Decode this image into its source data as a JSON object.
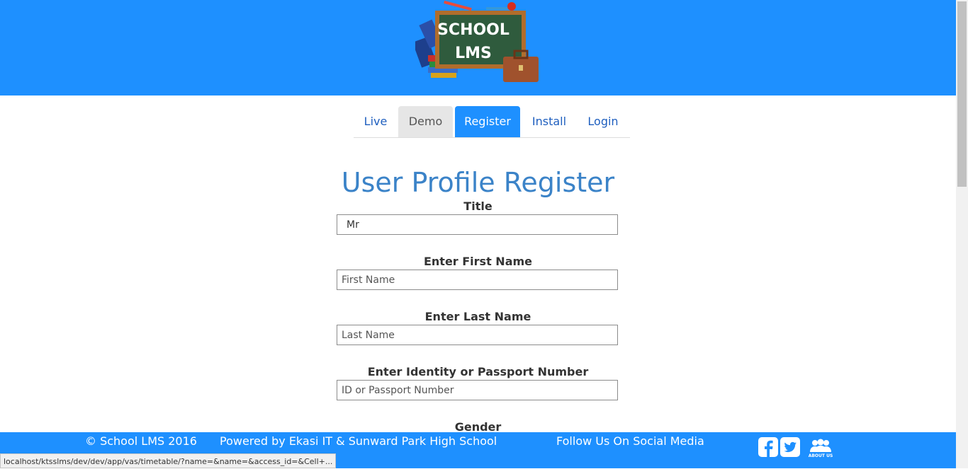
{
  "header": {
    "logo_line1": "SCHOOL",
    "logo_line2": "LMS",
    "color": "#1e90ff"
  },
  "nav": {
    "tabs": [
      {
        "label": "Live"
      },
      {
        "label": "Demo"
      },
      {
        "label": "Register",
        "active": true
      },
      {
        "label": "Install"
      },
      {
        "label": "Login"
      }
    ]
  },
  "form": {
    "title": "User Profile Register",
    "fields": [
      {
        "label": "Title",
        "value": "Mr",
        "placeholder": ""
      },
      {
        "label": "Enter First Name",
        "value": "",
        "placeholder": "First Name"
      },
      {
        "label": "Enter Last Name",
        "value": "",
        "placeholder": "Last Name"
      },
      {
        "label": "Enter Identity or Passport Number",
        "value": "",
        "placeholder": "ID or Passport Number"
      },
      {
        "label": "Gender"
      }
    ]
  },
  "footer": {
    "copyright": "© School LMS 2016",
    "powered": "Powered by Ekasi IT & Sunward Park High School",
    "follow": "Follow Us On Social Media",
    "about_label": "ABOUT US"
  },
  "status_bar": {
    "url": "localhost/ktsslms/dev/dev/app/vas/timetable/?name=&name=&access_id=&Cell+..."
  }
}
